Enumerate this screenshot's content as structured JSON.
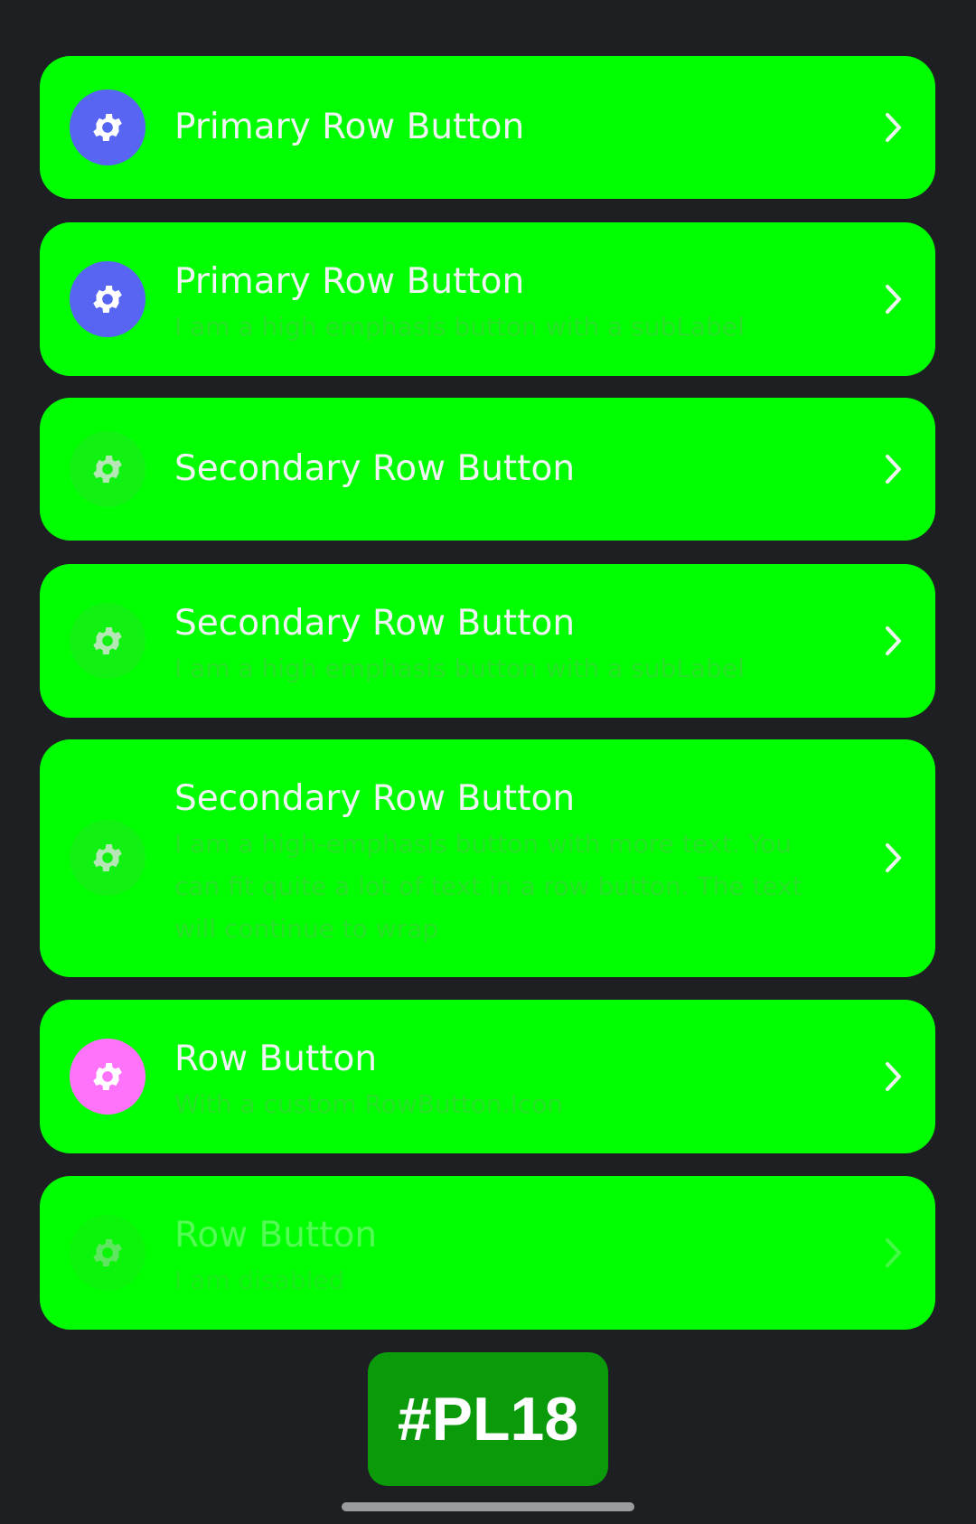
{
  "rows": [
    {
      "label": "Primary Row Button",
      "sub": "",
      "icon": "gear-icon",
      "icon_bg": "#5865f2",
      "icon_color": "#ffffff"
    },
    {
      "label": "Primary Row Button",
      "sub": "I am a high emphasis button with a subLabel",
      "icon": "gear-icon",
      "icon_bg": "#5865f2",
      "icon_color": "#ffffff"
    },
    {
      "label": "Secondary Row Button",
      "sub": "",
      "icon": "gear-icon",
      "icon_bg": "#12f212",
      "icon_color": "#b5e6b5"
    },
    {
      "label": "Secondary Row Button",
      "sub": "I am a high emphasis button with a subLabel",
      "icon": "gear-icon",
      "icon_bg": "#12f212",
      "icon_color": "#b5e6b5"
    },
    {
      "label": "Secondary Row Button",
      "sub": "I am a high-emphasis button with more text. You can fit quite a lot of text in a row button. The text will continue to wrap",
      "icon": "gear-icon",
      "icon_bg": "#12f212",
      "icon_color": "#b5e6b5"
    },
    {
      "label": "Row Button",
      "sub": "With a custom RowButton.Icon",
      "icon": "gear-icon",
      "icon_bg": "#ff73fa",
      "icon_color": "#ffffff"
    },
    {
      "label": "Row Button",
      "sub": "I am disabled",
      "icon": "gear-icon",
      "icon_bg": "#0af50a",
      "icon_color": "#5fe55f",
      "disabled": true
    }
  ],
  "chevron_icon": "chevron-right-icon",
  "badge": {
    "text": "#PL18"
  }
}
